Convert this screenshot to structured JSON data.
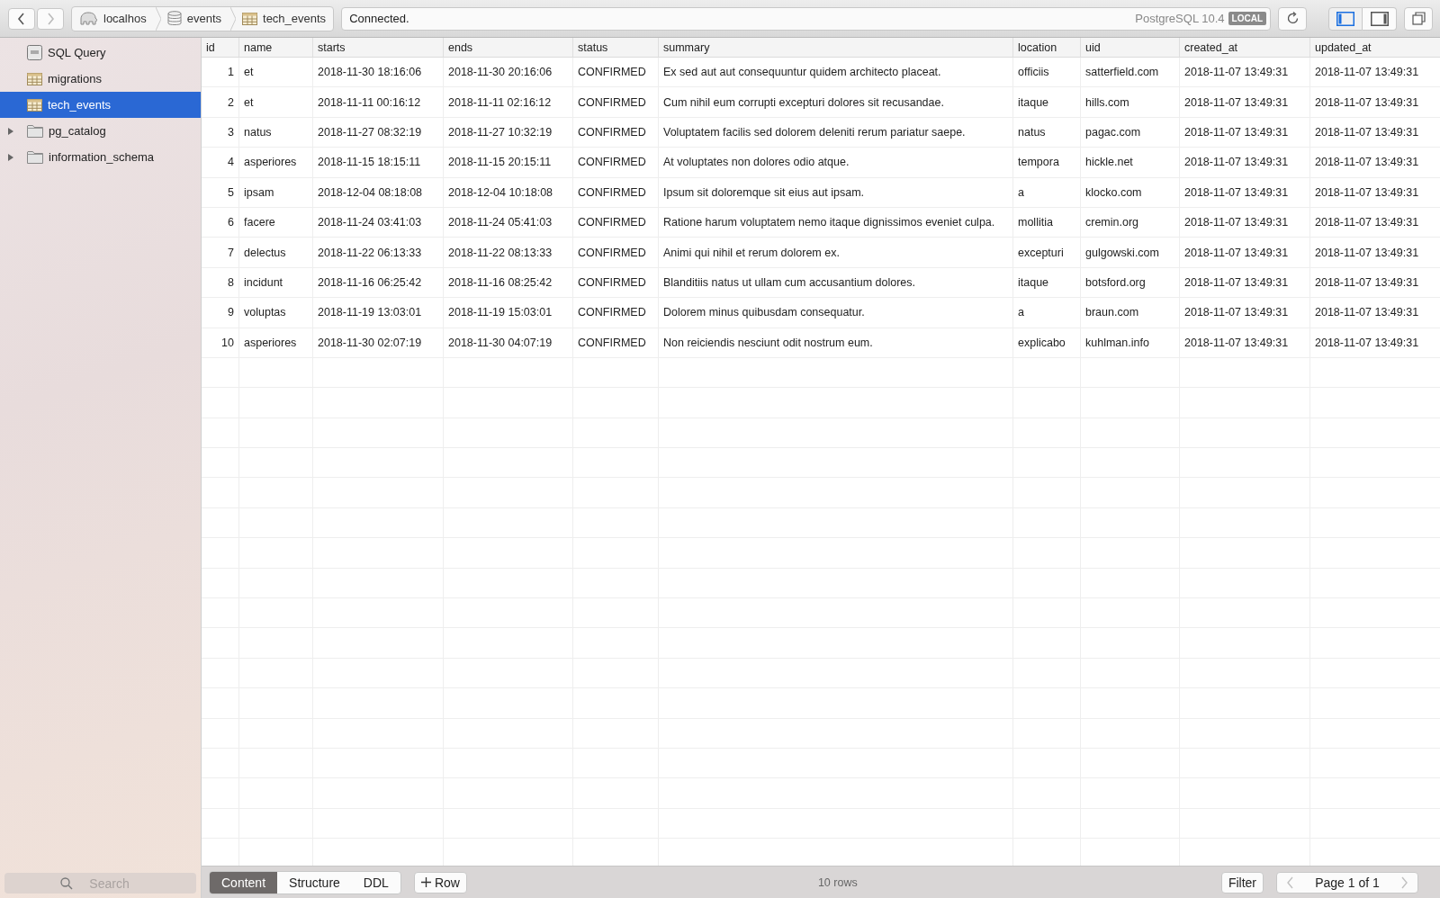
{
  "toolbar": {
    "back_disabled": false,
    "forward_disabled": true,
    "breadcrumb": [
      {
        "label": "localhos",
        "kind": "server"
      },
      {
        "label": "events",
        "kind": "database"
      },
      {
        "label": "tech_events",
        "kind": "table"
      }
    ],
    "status": "Connected.",
    "server": "PostgreSQL 10.4",
    "badge": "LOCAL",
    "panels": [
      {
        "kind": "left",
        "selected": true
      },
      {
        "kind": "right",
        "selected": false
      }
    ]
  },
  "sidebar": {
    "items": [
      {
        "label": "SQL Query",
        "kind": "sql",
        "selected": false
      },
      {
        "label": "migrations",
        "kind": "table",
        "selected": false
      },
      {
        "label": "tech_events",
        "kind": "table",
        "selected": true
      },
      {
        "label": "pg_catalog",
        "kind": "folder",
        "selected": false,
        "expanded": false
      },
      {
        "label": "information_schema",
        "kind": "folder",
        "selected": false,
        "expanded": false
      }
    ],
    "search": {
      "placeholder": "Search"
    }
  },
  "table": {
    "columns": [
      "id",
      "name",
      "starts",
      "ends",
      "status",
      "summary",
      "location",
      "uid",
      "created_at",
      "updated_at"
    ],
    "rows": [
      [
        "1",
        "et",
        "2018-11-30 18:16:06",
        "2018-11-30 20:16:06",
        "CONFIRMED",
        "Ex sed aut aut consequuntur quidem architecto placeat.",
        "officiis",
        "satterfield.com",
        "2018-11-07 13:49:31",
        "2018-11-07 13:49:31"
      ],
      [
        "2",
        "et",
        "2018-11-11 00:16:12",
        "2018-11-11 02:16:12",
        "CONFIRMED",
        "Cum nihil eum corrupti excepturi dolores sit recusandae.",
        "itaque",
        "hills.com",
        "2018-11-07 13:49:31",
        "2018-11-07 13:49:31"
      ],
      [
        "3",
        "natus",
        "2018-11-27 08:32:19",
        "2018-11-27 10:32:19",
        "CONFIRMED",
        "Voluptatem facilis sed dolorem deleniti rerum pariatur saepe.",
        "natus",
        "pagac.com",
        "2018-11-07 13:49:31",
        "2018-11-07 13:49:31"
      ],
      [
        "4",
        "asperiores",
        "2018-11-15 18:15:11",
        "2018-11-15 20:15:11",
        "CONFIRMED",
        "At voluptates non dolores odio atque.",
        "tempora",
        "hickle.net",
        "2018-11-07 13:49:31",
        "2018-11-07 13:49:31"
      ],
      [
        "5",
        "ipsam",
        "2018-12-04 08:18:08",
        "2018-12-04 10:18:08",
        "CONFIRMED",
        "Ipsum sit doloremque sit eius aut ipsam.",
        "a",
        "klocko.com",
        "2018-11-07 13:49:31",
        "2018-11-07 13:49:31"
      ],
      [
        "6",
        "facere",
        "2018-11-24 03:41:03",
        "2018-11-24 05:41:03",
        "CONFIRMED",
        "Ratione harum voluptatem nemo itaque dignissimos eveniet culpa.",
        "mollitia",
        "cremin.org",
        "2018-11-07 13:49:31",
        "2018-11-07 13:49:31"
      ],
      [
        "7",
        "delectus",
        "2018-11-22 06:13:33",
        "2018-11-22 08:13:33",
        "CONFIRMED",
        "Animi qui nihil et rerum dolorem ex.",
        "excepturi",
        "gulgowski.com",
        "2018-11-07 13:49:31",
        "2018-11-07 13:49:31"
      ],
      [
        "8",
        "incidunt",
        "2018-11-16 06:25:42",
        "2018-11-16 08:25:42",
        "CONFIRMED",
        "Blanditiis natus ut ullam cum accusantium dolores.",
        "itaque",
        "botsford.org",
        "2018-11-07 13:49:31",
        "2018-11-07 13:49:31"
      ],
      [
        "9",
        "voluptas",
        "2018-11-19 13:03:01",
        "2018-11-19 15:03:01",
        "CONFIRMED",
        "Dolorem minus quibusdam consequatur.",
        "a",
        "braun.com",
        "2018-11-07 13:49:31",
        "2018-11-07 13:49:31"
      ],
      [
        "10",
        "asperiores",
        "2018-11-30 02:07:19",
        "2018-11-30 04:07:19",
        "CONFIRMED",
        "Non reiciendis nesciunt odit nostrum eum.",
        "explicabo",
        "kuhlman.info",
        "2018-11-07 13:49:31",
        "2018-11-07 13:49:31"
      ]
    ]
  },
  "footer": {
    "tabs": [
      {
        "label": "Content",
        "selected": true
      },
      {
        "label": "Structure",
        "selected": false
      },
      {
        "label": "DDL",
        "selected": false
      }
    ],
    "add_row": "Row",
    "row_count": "10 rows",
    "filter": "Filter",
    "pagination": "Page 1 of 1",
    "prev_disabled": true,
    "next_disabled": true
  }
}
